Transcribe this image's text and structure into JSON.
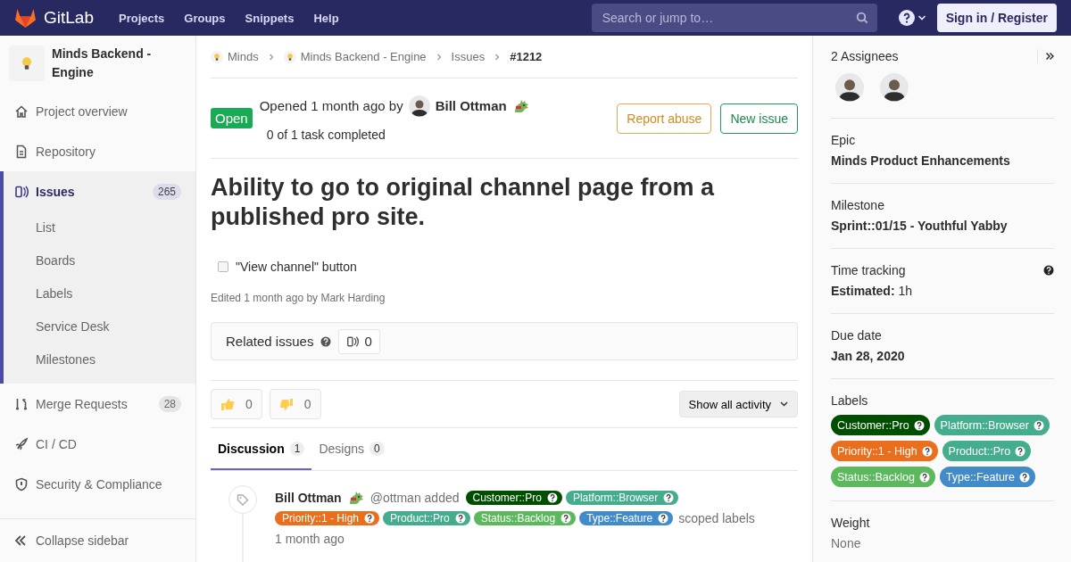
{
  "header": {
    "logo": "GitLab",
    "nav": [
      "Projects",
      "Groups",
      "Snippets",
      "Help"
    ],
    "search": {
      "placeholder": "Search or jump to…"
    },
    "sign_in": "Sign in / Register"
  },
  "sidebar": {
    "project": "Minds Backend - Engine",
    "items": [
      {
        "label": "Project overview",
        "selected": false
      },
      {
        "label": "Repository",
        "selected": false
      },
      {
        "label": "Issues",
        "count": "265",
        "selected": true,
        "children": [
          {
            "label": "List",
            "selected": false
          },
          {
            "label": "Boards",
            "selected": false
          },
          {
            "label": "Labels",
            "selected": false
          },
          {
            "label": "Service Desk",
            "selected": false
          },
          {
            "label": "Milestones",
            "selected": false
          }
        ]
      },
      {
        "label": "Merge Requests",
        "count": "28",
        "selected": false
      },
      {
        "label": "CI / CD",
        "selected": false
      },
      {
        "label": "Security & Compliance",
        "selected": false
      }
    ],
    "collapse": "Collapse sidebar"
  },
  "breadcrumbs": [
    "Minds",
    "Minds Backend - Engine",
    "Issues",
    "#1212"
  ],
  "issue": {
    "status": "Open",
    "opened": "Opened 1 month ago by",
    "author": "Bill Ottman",
    "tasks_status": "0 of 1 task completed",
    "actions": [
      "Report abuse",
      "New issue"
    ],
    "title": "Ability to go to original channel page from a published pro site.",
    "tasks": [
      {
        "label": "\"View channel\" button",
        "checked": false
      }
    ],
    "edited": "Edited 1 month ago by Mark Harding"
  },
  "related_issues": {
    "label": "Related issues",
    "count": "0"
  },
  "awards": [
    {
      "count": "0"
    },
    {
      "count": "0"
    }
  ],
  "activity_filter": "Show all activity",
  "tabs": [
    {
      "label": "Discussion",
      "count": "1",
      "selected": true
    },
    {
      "label": "Designs",
      "count": "0",
      "selected": false
    }
  ],
  "notes": [
    {
      "author": "Bill Ottman",
      "action": "@ottman added",
      "labels": [
        {
          "name": "Customer::Pro",
          "color": "#004e00"
        },
        {
          "name": "Platform::Browser",
          "color": "#44ad8e"
        },
        {
          "name": "Priority::1 - High",
          "color": "#ea6f1d"
        },
        {
          "name": "Product::Pro",
          "color": "#44ad8e"
        },
        {
          "name": "Status::Backlog",
          "color": "#5cb85c"
        },
        {
          "name": "Type::Feature",
          "color": "#428bca"
        }
      ],
      "suffix": "scoped labels",
      "time": "1 month ago"
    }
  ],
  "aside": {
    "assignees_title": "2 Assignees",
    "sections": [
      {
        "kind": "text",
        "title": "Epic",
        "value": "Minds Product Enhancements"
      },
      {
        "kind": "text",
        "title": "Milestone",
        "value": "Sprint::01/15 - Youthful Yabby"
      },
      {
        "kind": "time",
        "title": "Time tracking",
        "value_label": "Estimated:",
        "value": "1h"
      },
      {
        "kind": "text",
        "title": "Due date",
        "value": "Jan 28, 2020"
      },
      {
        "kind": "labels",
        "title": "Labels",
        "labels": [
          {
            "name": "Customer::Pro",
            "color": "#004e00"
          },
          {
            "name": "Platform::Browser",
            "color": "#44ad8e"
          },
          {
            "name": "Priority::1 - High",
            "color": "#ea6f1d"
          },
          {
            "name": "Product::Pro",
            "color": "#44ad8e"
          },
          {
            "name": "Status::Backlog",
            "color": "#5cb85c"
          },
          {
            "name": "Type::Feature",
            "color": "#428bca"
          }
        ]
      },
      {
        "kind": "muted",
        "title": "Weight",
        "value": "None"
      }
    ]
  }
}
